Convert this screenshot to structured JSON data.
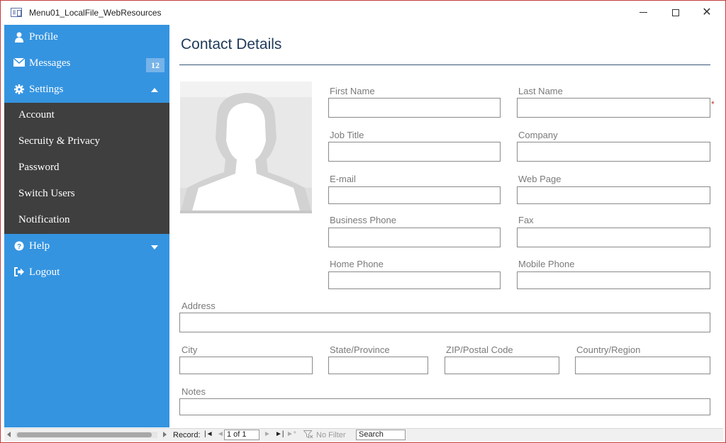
{
  "window": {
    "title": "Menu01_LocalFile_WebResources",
    "controls": {
      "minimize_icon": "minimize-icon",
      "maximize_icon": "maximize-icon",
      "close_glyph": "✕"
    }
  },
  "sidebar": {
    "background_color": "#3594e0",
    "submenu_color": "#3f3f3f",
    "items": [
      {
        "label": "Profile",
        "icon": "user-icon"
      },
      {
        "label": "Messages",
        "icon": "envelope-icon",
        "badge": "12"
      },
      {
        "label": "Settings",
        "icon": "gear-icon",
        "expanded": true
      },
      {
        "label": "Help",
        "icon": "question-icon",
        "expanded": false
      },
      {
        "label": "Logout",
        "icon": "sign-out-icon"
      }
    ],
    "settings_submenu": [
      {
        "label": "Account"
      },
      {
        "label": "Secruity & Privacy"
      },
      {
        "label": "Password"
      },
      {
        "label": "Switch Users"
      },
      {
        "label": "Notification"
      }
    ]
  },
  "form": {
    "title": "Contact Details",
    "photo": "person-placeholder-image",
    "fields": {
      "first_name": {
        "label": "First Name",
        "value": ""
      },
      "last_name": {
        "label": "Last Name",
        "value": "",
        "required_mark": "*"
      },
      "job_title": {
        "label": "Job Title",
        "value": ""
      },
      "company": {
        "label": "Company",
        "value": ""
      },
      "email": {
        "label": "E-mail",
        "value": ""
      },
      "web_page": {
        "label": "Web Page",
        "value": ""
      },
      "business_phone": {
        "label": "Business Phone",
        "value": ""
      },
      "fax": {
        "label": "Fax",
        "value": ""
      },
      "home_phone": {
        "label": "Home Phone",
        "value": ""
      },
      "mobile_phone": {
        "label": "Mobile Phone",
        "value": ""
      },
      "address": {
        "label": "Address",
        "value": ""
      },
      "city": {
        "label": "City",
        "value": ""
      },
      "state": {
        "label": "State/Province",
        "value": ""
      },
      "zip": {
        "label": "ZIP/Postal Code",
        "value": ""
      },
      "country": {
        "label": "Country/Region",
        "value": ""
      },
      "notes": {
        "label": "Notes",
        "value": ""
      }
    }
  },
  "statusbar": {
    "record_label": "Record:",
    "record_value": "1 of 1",
    "filter_label": "No Filter",
    "search_placeholder": "Search"
  }
}
